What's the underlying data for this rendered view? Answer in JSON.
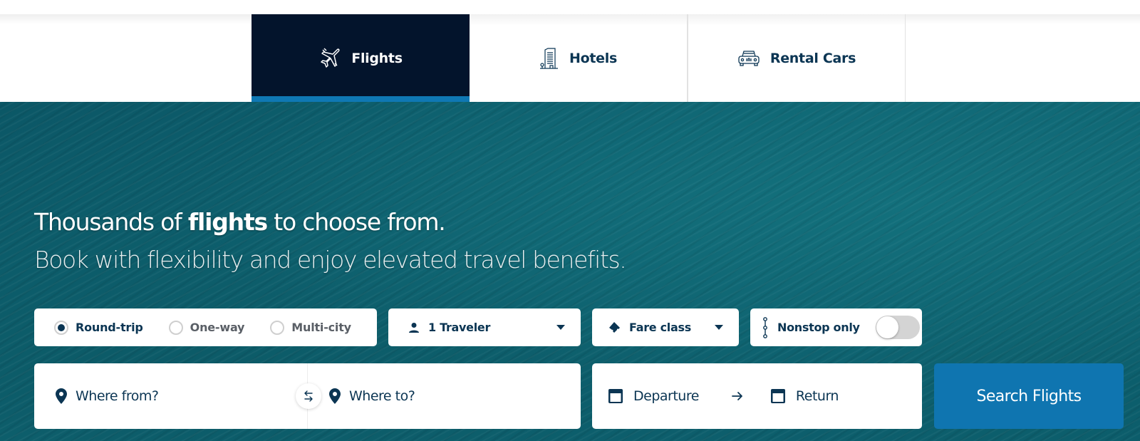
{
  "tabs": [
    {
      "label": "Flights",
      "icon": "airplane-icon",
      "active": true
    },
    {
      "label": "Hotels",
      "icon": "hotel-building-icon",
      "active": false
    },
    {
      "label": "Rental Cars",
      "icon": "car-icon",
      "active": false
    }
  ],
  "hero": {
    "headline_prefix": "Thousands of ",
    "headline_bold": "flights",
    "headline_suffix": " to choose from.",
    "subheadline": "Book with flexibility and enjoy elevated travel benefits."
  },
  "search": {
    "trip_types": [
      {
        "label": "Round-trip",
        "selected": true
      },
      {
        "label": "One-way",
        "selected": false
      },
      {
        "label": "Multi-city",
        "selected": false
      }
    ],
    "travelers": {
      "label": "1 Traveler",
      "icon": "person-icon"
    },
    "fare_class": {
      "label": "Fare class",
      "icon": "ticket-icon"
    },
    "nonstop": {
      "label": "Nonstop only",
      "icon": "route-stops-icon",
      "enabled": false
    },
    "origin": {
      "placeholder": "Where from?",
      "value": ""
    },
    "destination": {
      "placeholder": "Where to?",
      "value": ""
    },
    "departure": {
      "placeholder": "Departure"
    },
    "return": {
      "placeholder": "Return"
    },
    "submit_label": "Search Flights"
  },
  "colors": {
    "active_tab_bg": "#03142c",
    "active_tab_underline": "#0f78b4",
    "text_primary": "#0b3553",
    "search_button": "#0f75b0"
  }
}
